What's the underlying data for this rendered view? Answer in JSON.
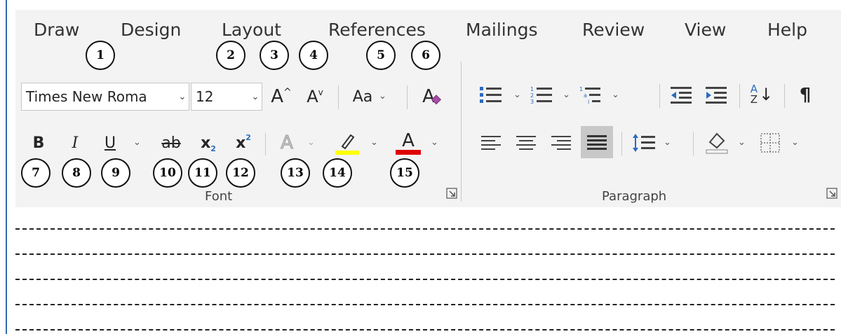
{
  "tabs": [
    "Draw",
    "Design",
    "Layout",
    "References",
    "Mailings",
    "Review",
    "View",
    "Help"
  ],
  "font_group": {
    "label": "Font",
    "font_name": "Times New Roma",
    "font_size": "12",
    "grow_font": "A",
    "shrink_font": "A",
    "change_case": "Aa",
    "clear_format": "A",
    "bold": "B",
    "italic": "I",
    "underline": "U",
    "strikethrough": "ab",
    "subscript": "x",
    "subscript_mark": "2",
    "superscript": "x",
    "superscript_mark": "2",
    "text_effects": "A",
    "font_color": "A"
  },
  "paragraph_group": {
    "label": "Paragraph",
    "sort": "A",
    "sort2": "Z",
    "pilcrow": "¶"
  },
  "callouts": [
    "1",
    "2",
    "3",
    "4",
    "5",
    "6",
    "7",
    "8",
    "9",
    "10",
    "11",
    "12",
    "13",
    "14",
    "15"
  ],
  "colors": {
    "highlight": "#ffff00",
    "font_color": "#e00000",
    "accent": "#2f6bb3",
    "clear_format_eraser": "#a64ca6",
    "list_blue": "#2b6bbf"
  },
  "icons": [
    "bullets-icon",
    "numbering-icon",
    "multilevel-list-icon",
    "decrease-indent-icon",
    "increase-indent-icon",
    "sort-icon",
    "pilcrow-icon",
    "align-left-icon",
    "align-center-icon",
    "align-right-icon",
    "justify-icon",
    "line-spacing-icon",
    "shading-icon",
    "borders-icon",
    "highlighter-icon",
    "dialog-launcher-icon"
  ]
}
